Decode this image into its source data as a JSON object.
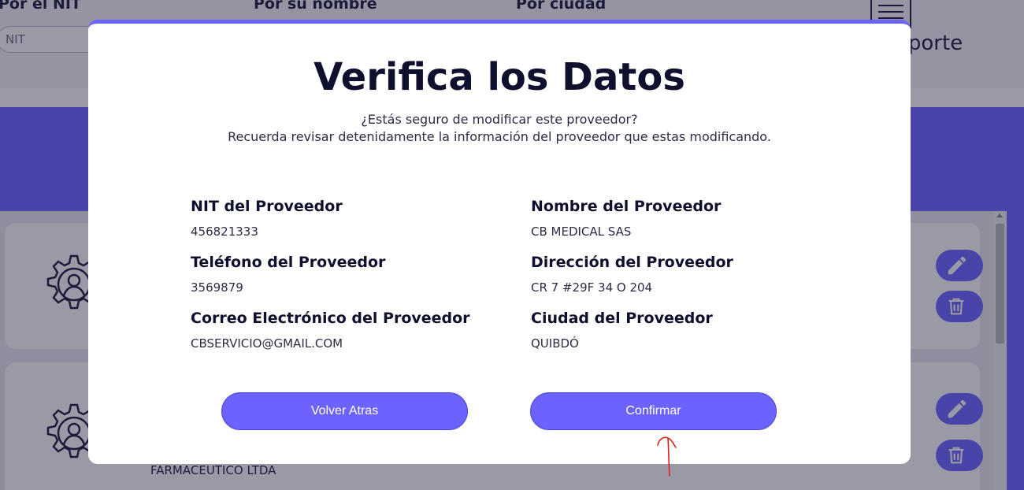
{
  "background": {
    "filters": [
      {
        "label": "Por el NIT"
      },
      {
        "label": "Por su nombre"
      },
      {
        "label": "Por ciudad"
      }
    ],
    "nit_input": {
      "placeholder": "NIT"
    },
    "report_label": "Reporte",
    "list": [
      {
        "text": ""
      },
      {
        "text": "FARMACEUTICO LTDA"
      }
    ]
  },
  "modal": {
    "title": "Verifica los Datos",
    "subtitle_line1": "¿Estás seguro de modificar este proveedor?",
    "subtitle_line2": "Recuerda revisar detenidamente la información del proveedor que estas modificando.",
    "fields": {
      "nit": {
        "label": "NIT del Proveedor",
        "value": "456821333"
      },
      "nombre": {
        "label": "Nombre del Proveedor",
        "value": "CB MEDICAL SAS"
      },
      "telefono": {
        "label": "Teléfono del Proveedor",
        "value": "3569879"
      },
      "direccion": {
        "label": "Dirección del Proveedor",
        "value": "CR 7 #29F 34 O 204"
      },
      "correo": {
        "label": "Correo Electrónico del Proveedor",
        "value": "CBSERVICIO@GMAIL.COM"
      },
      "ciudad": {
        "label": "Ciudad del Proveedor",
        "value": "QUIBDÓ"
      }
    },
    "back_button": "Volver Atras",
    "confirm_button": "Confirmar"
  },
  "colors": {
    "accent": "#6c63ff",
    "title": "#0f0f2e",
    "annotation": "#e0201a"
  }
}
